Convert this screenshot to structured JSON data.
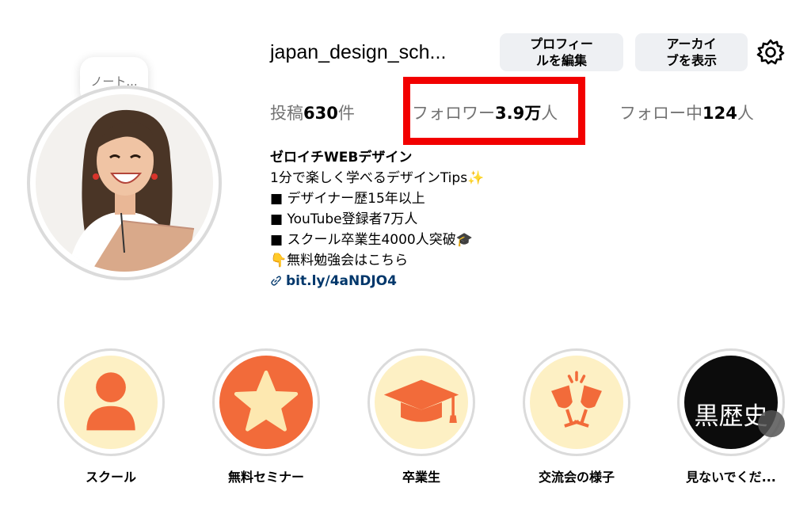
{
  "profile": {
    "username": "japan_design_sch...",
    "note_text": "ノート...",
    "edit_profile_label_line1": "プロフィー",
    "edit_profile_label_line2": "ルを編集",
    "archive_label_line1": "アーカイ",
    "archive_label_line2": "ブを表示",
    "settings_icon": "gear-icon"
  },
  "stats": {
    "posts_prefix": "投稿",
    "posts_value": "630",
    "posts_suffix": "件",
    "followers_prefix": "フォロワー",
    "followers_value": "3.9万",
    "followers_suffix": "人",
    "following_prefix": "フォロー中",
    "following_value": "124",
    "following_suffix": "人"
  },
  "bio": {
    "name": "ゼロイチWEBデザイン",
    "line1": "1分で楽しく学べるデザインTips✨",
    "line2": "■ デザイナー歴15年以上",
    "line3": "■ YouTube登録者7万人",
    "line4": "■ スクール卒業生4000人突破🎓",
    "line5": "👇無料勉強会はこちら",
    "link": "bit.ly/4aNDJO4"
  },
  "highlights": [
    {
      "label": "スクール",
      "icon": "person-icon"
    },
    {
      "label": "無料セミナー",
      "icon": "star-icon"
    },
    {
      "label": "卒業生",
      "icon": "graduation-cap-icon"
    },
    {
      "label": "交流会の様子",
      "icon": "cheers-glasses-icon"
    },
    {
      "label": "見ないでくだ...",
      "cover_text": "黒歴史"
    }
  ],
  "colors": {
    "highlight_box": "#f20000",
    "button_bg": "#eef0f3",
    "link": "#00376b",
    "highlight_orange": "#f26b3a",
    "highlight_cream": "#fdf0c4"
  }
}
